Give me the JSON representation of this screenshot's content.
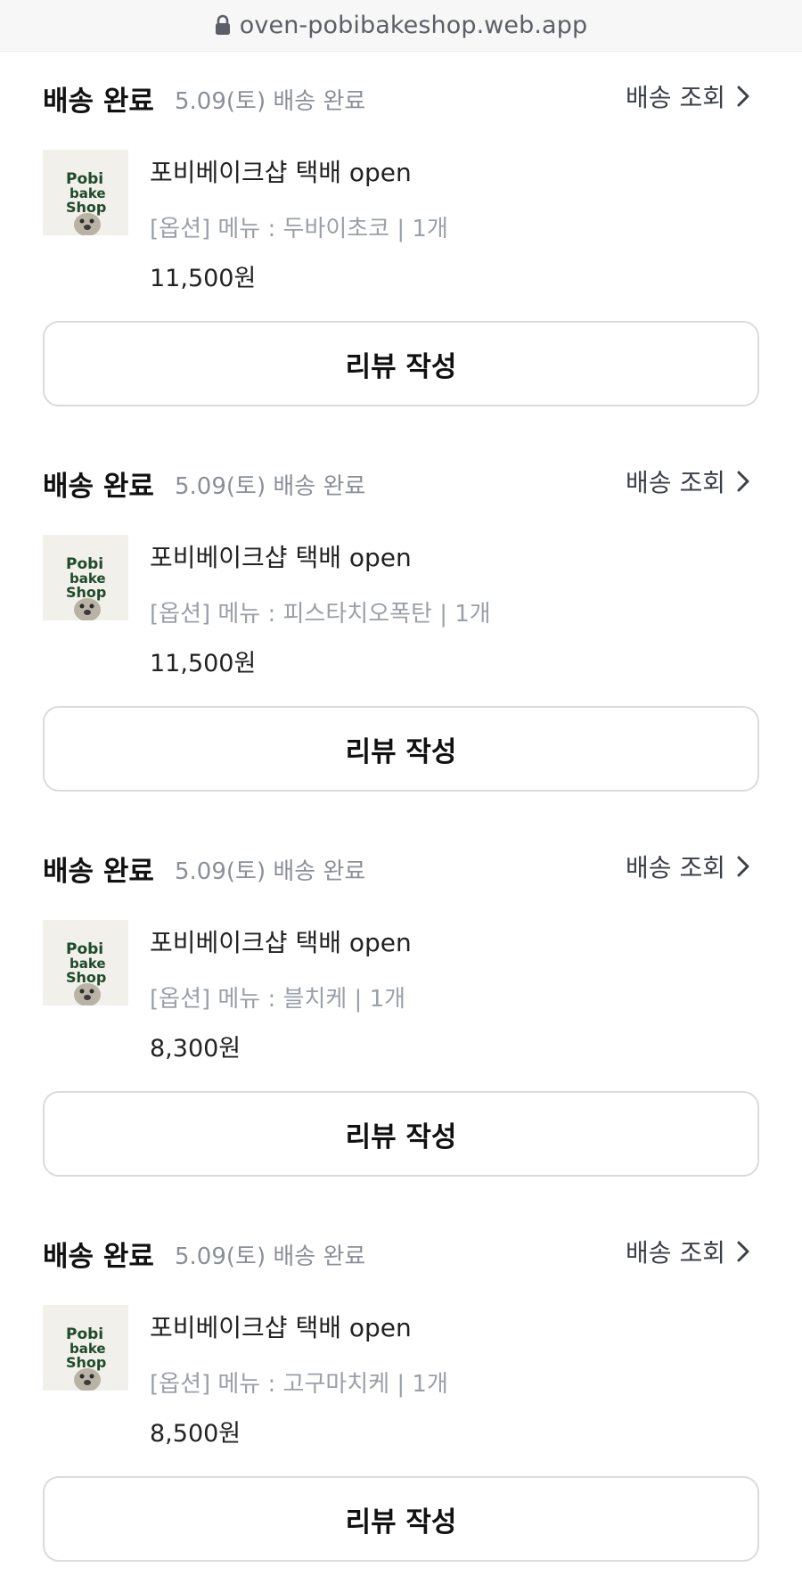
{
  "browser": {
    "url": "oven-pobibakeshop.web.app"
  },
  "orders": [
    {
      "status_title": "배송 완료",
      "status_sub": "5.09(토) 배송 완료",
      "track_label": "배송 조회",
      "product_name": "포비베이크샵 택배 open",
      "option": "[옵션] 메뉴 : 두바이초코 | 1개",
      "price": "11,500원",
      "review_label": "리뷰 작성",
      "thumb_icon": "pobi-bakeshop-logo"
    },
    {
      "status_title": "배송 완료",
      "status_sub": "5.09(토) 배송 완료",
      "track_label": "배송 조회",
      "product_name": "포비베이크샵 택배 open",
      "option": "[옵션] 메뉴 : 피스타치오폭탄 | 1개",
      "price": "11,500원",
      "review_label": "리뷰 작성",
      "thumb_icon": "pobi-bakeshop-logo"
    },
    {
      "status_title": "배송 완료",
      "status_sub": "5.09(토) 배송 완료",
      "track_label": "배송 조회",
      "product_name": "포비베이크샵 택배 open",
      "option": "[옵션] 메뉴 : 블치케 | 1개",
      "price": "8,300원",
      "review_label": "리뷰 작성",
      "thumb_icon": "pobi-bakeshop-logo"
    },
    {
      "status_title": "배송 완료",
      "status_sub": "5.09(토) 배송 완료",
      "track_label": "배송 조회",
      "product_name": "포비베이크샵 택배 open",
      "option": "[옵션] 메뉴 : 고구마치케 | 1개",
      "price": "8,500원",
      "review_label": "리뷰 작성",
      "thumb_icon": "pobi-bakeshop-logo"
    }
  ],
  "colors": {
    "muted_text": "#8a9099",
    "option_text": "#9aa0a8",
    "button_border": "#d9dbe0",
    "logo_green": "#1f4a2c"
  }
}
